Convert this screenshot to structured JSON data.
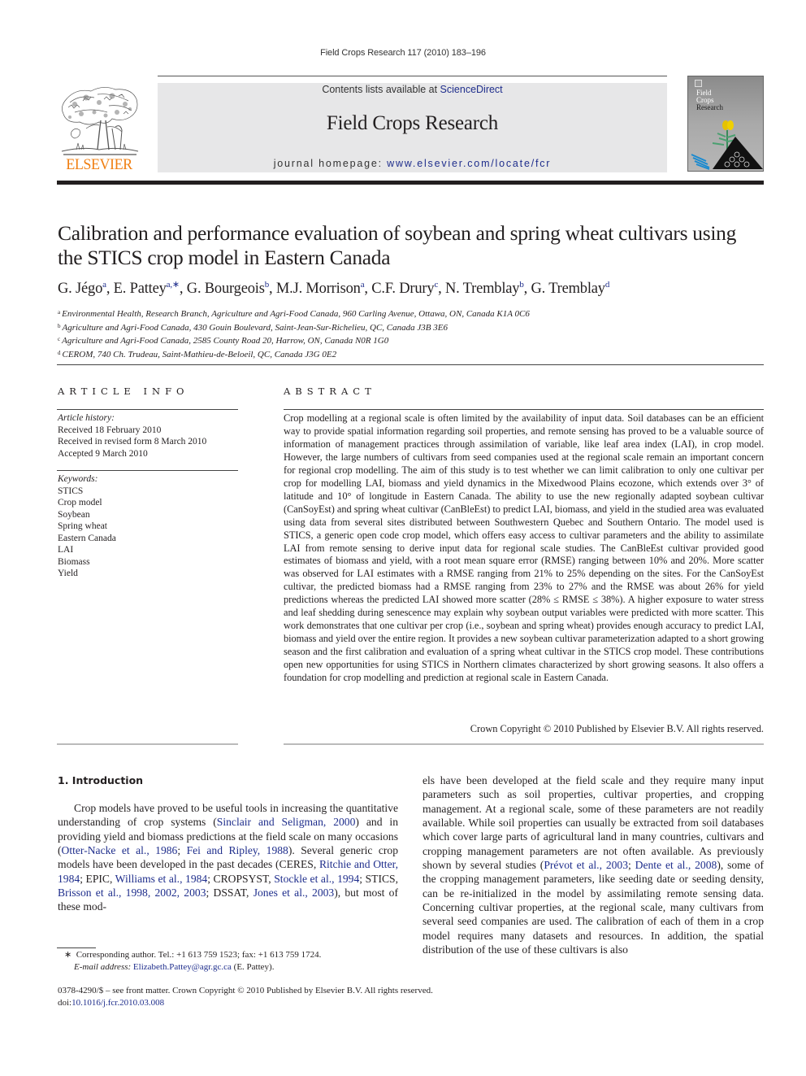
{
  "running_head": "Field Crops Research 117 (2010) 183–196",
  "masthead": {
    "contents_prefix": "Contents lists available at ",
    "contents_link": "ScienceDirect",
    "journal_title": "Field Crops Research",
    "homepage_prefix": "journal homepage: ",
    "homepage_link": "www.elsevier.com/locate/fcr",
    "publisher_logo_text": "ELSEVIER",
    "cover_title_lines": [
      "Field",
      "Crops",
      "Research"
    ]
  },
  "colors": {
    "link": "#1f2e8c",
    "elsevier_orange": "#f07f12",
    "masthead_bg": "#e7e7e8"
  },
  "article": {
    "title": "Calibration and performance evaluation of soybean and spring wheat cultivars using the STICS crop model in Eastern Canada",
    "authors": [
      {
        "name": "G. Jégo",
        "sup": "a"
      },
      {
        "name": "E. Pattey",
        "sup": "a,∗"
      },
      {
        "name": "G. Bourgeois",
        "sup": "b"
      },
      {
        "name": "M.J. Morrison",
        "sup": "a"
      },
      {
        "name": "C.F. Drury",
        "sup": "c"
      },
      {
        "name": "N. Tremblay",
        "sup": "b"
      },
      {
        "name": "G. Tremblay",
        "sup": "d"
      }
    ],
    "affiliations": [
      {
        "key": "a",
        "text": "Environmental Health, Research Branch, Agriculture and Agri-Food Canada, 960 Carling Avenue, Ottawa, ON, Canada K1A 0C6"
      },
      {
        "key": "b",
        "text": "Agriculture and Agri-Food Canada, 430 Gouin Boulevard, Saint-Jean-Sur-Richelieu, QC, Canada J3B 3E6"
      },
      {
        "key": "c",
        "text": "Agriculture and Agri-Food Canada, 2585 County Road 20, Harrow, ON, Canada N0R 1G0"
      },
      {
        "key": "d",
        "text": "CEROM, 740 Ch. Trudeau, Saint-Mathieu-de-Beloeil, QC, Canada J3G 0E2"
      }
    ]
  },
  "article_info": {
    "heading": "ARTICLE INFO",
    "history_label": "Article history:",
    "history": [
      "Received 18 February 2010",
      "Received in revised form 8 March 2010",
      "Accepted 9 March 2010"
    ],
    "keywords_label": "Keywords:",
    "keywords": [
      "STICS",
      "Crop model",
      "Soybean",
      "Spring wheat",
      "Eastern Canada",
      "LAI",
      "Biomass",
      "Yield"
    ]
  },
  "abstract": {
    "heading": "ABSTRACT",
    "text": "Crop modelling at a regional scale is often limited by the availability of input data. Soil databases can be an efficient way to provide spatial information regarding soil properties, and remote sensing has proved to be a valuable source of information of management practices through assimilation of variable, like leaf area index (LAI), in crop model. However, the large numbers of cultivars from seed companies used at the regional scale remain an important concern for regional crop modelling. The aim of this study is to test whether we can limit calibration to only one cultivar per crop for modelling LAI, biomass and yield dynamics in the Mixedwood Plains ecozone, which extends over 3° of latitude and 10° of longitude in Eastern Canada. The ability to use the new regionally adapted soybean cultivar (CanSoyEst) and spring wheat cultivar (CanBleEst) to predict LAI, biomass, and yield in the studied area was evaluated using data from several sites distributed between Southwestern Quebec and Southern Ontario. The model used is STICS, a generic open code crop model, which offers easy access to cultivar parameters and the ability to assimilate LAI from remote sensing to derive input data for regional scale studies. The CanBleEst cultivar provided good estimates of biomass and yield, with a root mean square error (RMSE) ranging between 10% and 20%. More scatter was observed for LAI estimates with a RMSE ranging from 21% to 25% depending on the sites. For the CanSoyEst cultivar, the predicted biomass had a RMSE ranging from 23% to 27% and the RMSE was about 26% for yield predictions whereas the predicted LAI showed more scatter (28% ≤ RMSE ≤ 38%). A higher exposure to water stress and leaf shedding during senescence may explain why soybean output variables were predicted with more scatter. This work demonstrates that one cultivar per crop (i.e., soybean and spring wheat) provides enough accuracy to predict LAI, biomass and yield over the entire region. It provides a new soybean cultivar parameterization adapted to a short growing season and the first calibration and evaluation of a spring wheat cultivar in the STICS crop model. These contributions open new opportunities for using STICS in Northern climates characterized by short growing seasons. It also offers a foundation for crop modelling and prediction at regional scale in Eastern Canada.",
    "copyright": "Crown Copyright © 2010 Published by Elsevier B.V. All rights reserved."
  },
  "introduction": {
    "heading": "1.  Introduction",
    "left_segments": [
      {
        "t": "Crop models have proved to be useful tools in increasing the quantitative understanding of crop systems ("
      },
      {
        "t": "Sinclair and Seligman, 2000",
        "link": true
      },
      {
        "t": ") and in providing yield and biomass predictions at the field scale on many occasions ("
      },
      {
        "t": "Otter-Nacke et al., 1986",
        "link": true
      },
      {
        "t": "; "
      },
      {
        "t": "Fei and Ripley, 1988",
        "link": true
      },
      {
        "t": "). Several generic crop models have been developed in the past decades (CERES, "
      },
      {
        "t": "Ritchie and Otter, 1984",
        "link": true
      },
      {
        "t": "; EPIC, "
      },
      {
        "t": "Williams et al., 1984",
        "link": true
      },
      {
        "t": "; CROPSYST, "
      },
      {
        "t": "Stockle et al., 1994",
        "link": true
      },
      {
        "t": "; STICS, "
      },
      {
        "t": "Brisson et al., 1998, 2002, 2003",
        "link": true
      },
      {
        "t": "; DSSAT, "
      },
      {
        "t": "Jones et al., 2003",
        "link": true
      },
      {
        "t": "), but most of these mod-"
      }
    ],
    "right_segments": [
      {
        "t": "els have been developed at the field scale and they require many input parameters such as soil properties, cultivar properties, and cropping management. At a regional scale, some of these parameters are not readily available. While soil properties can usually be extracted from soil databases which cover large parts of agricultural land in many countries, cultivars and cropping management parameters are not often available. As previously shown by several studies ("
      },
      {
        "t": "Prévot et al., 2003",
        "link": true
      },
      {
        "t": "; "
      },
      {
        "t": "Dente et al., 2008",
        "link": true
      },
      {
        "t": "), some of the cropping management parameters, like seeding date or seeding density, can be re-initialized in the model by assimilating remote sensing data. Concerning cultivar properties, at the regional scale, many cultivars from several seed companies are used. The calibration of each of them in a crop model requires many datasets and resources. In addition, the spatial distribution of the use of these cultivars is also"
      }
    ]
  },
  "footnote": {
    "marker": "∗",
    "line1": "Corresponding author. Tel.: +1 613 759 1523; fax: +1 613 759 1724.",
    "email_label": "E-mail address:",
    "email": "Elizabeth.Pattey@agr.gc.ca",
    "email_suffix": " (E. Pattey)."
  },
  "front_matter": {
    "line1": "0378-4290/$ – see front matter. Crown Copyright © 2010 Published by Elsevier B.V. All rights reserved.",
    "doi_prefix": "doi:",
    "doi": "10.1016/j.fcr.2010.03.008"
  }
}
